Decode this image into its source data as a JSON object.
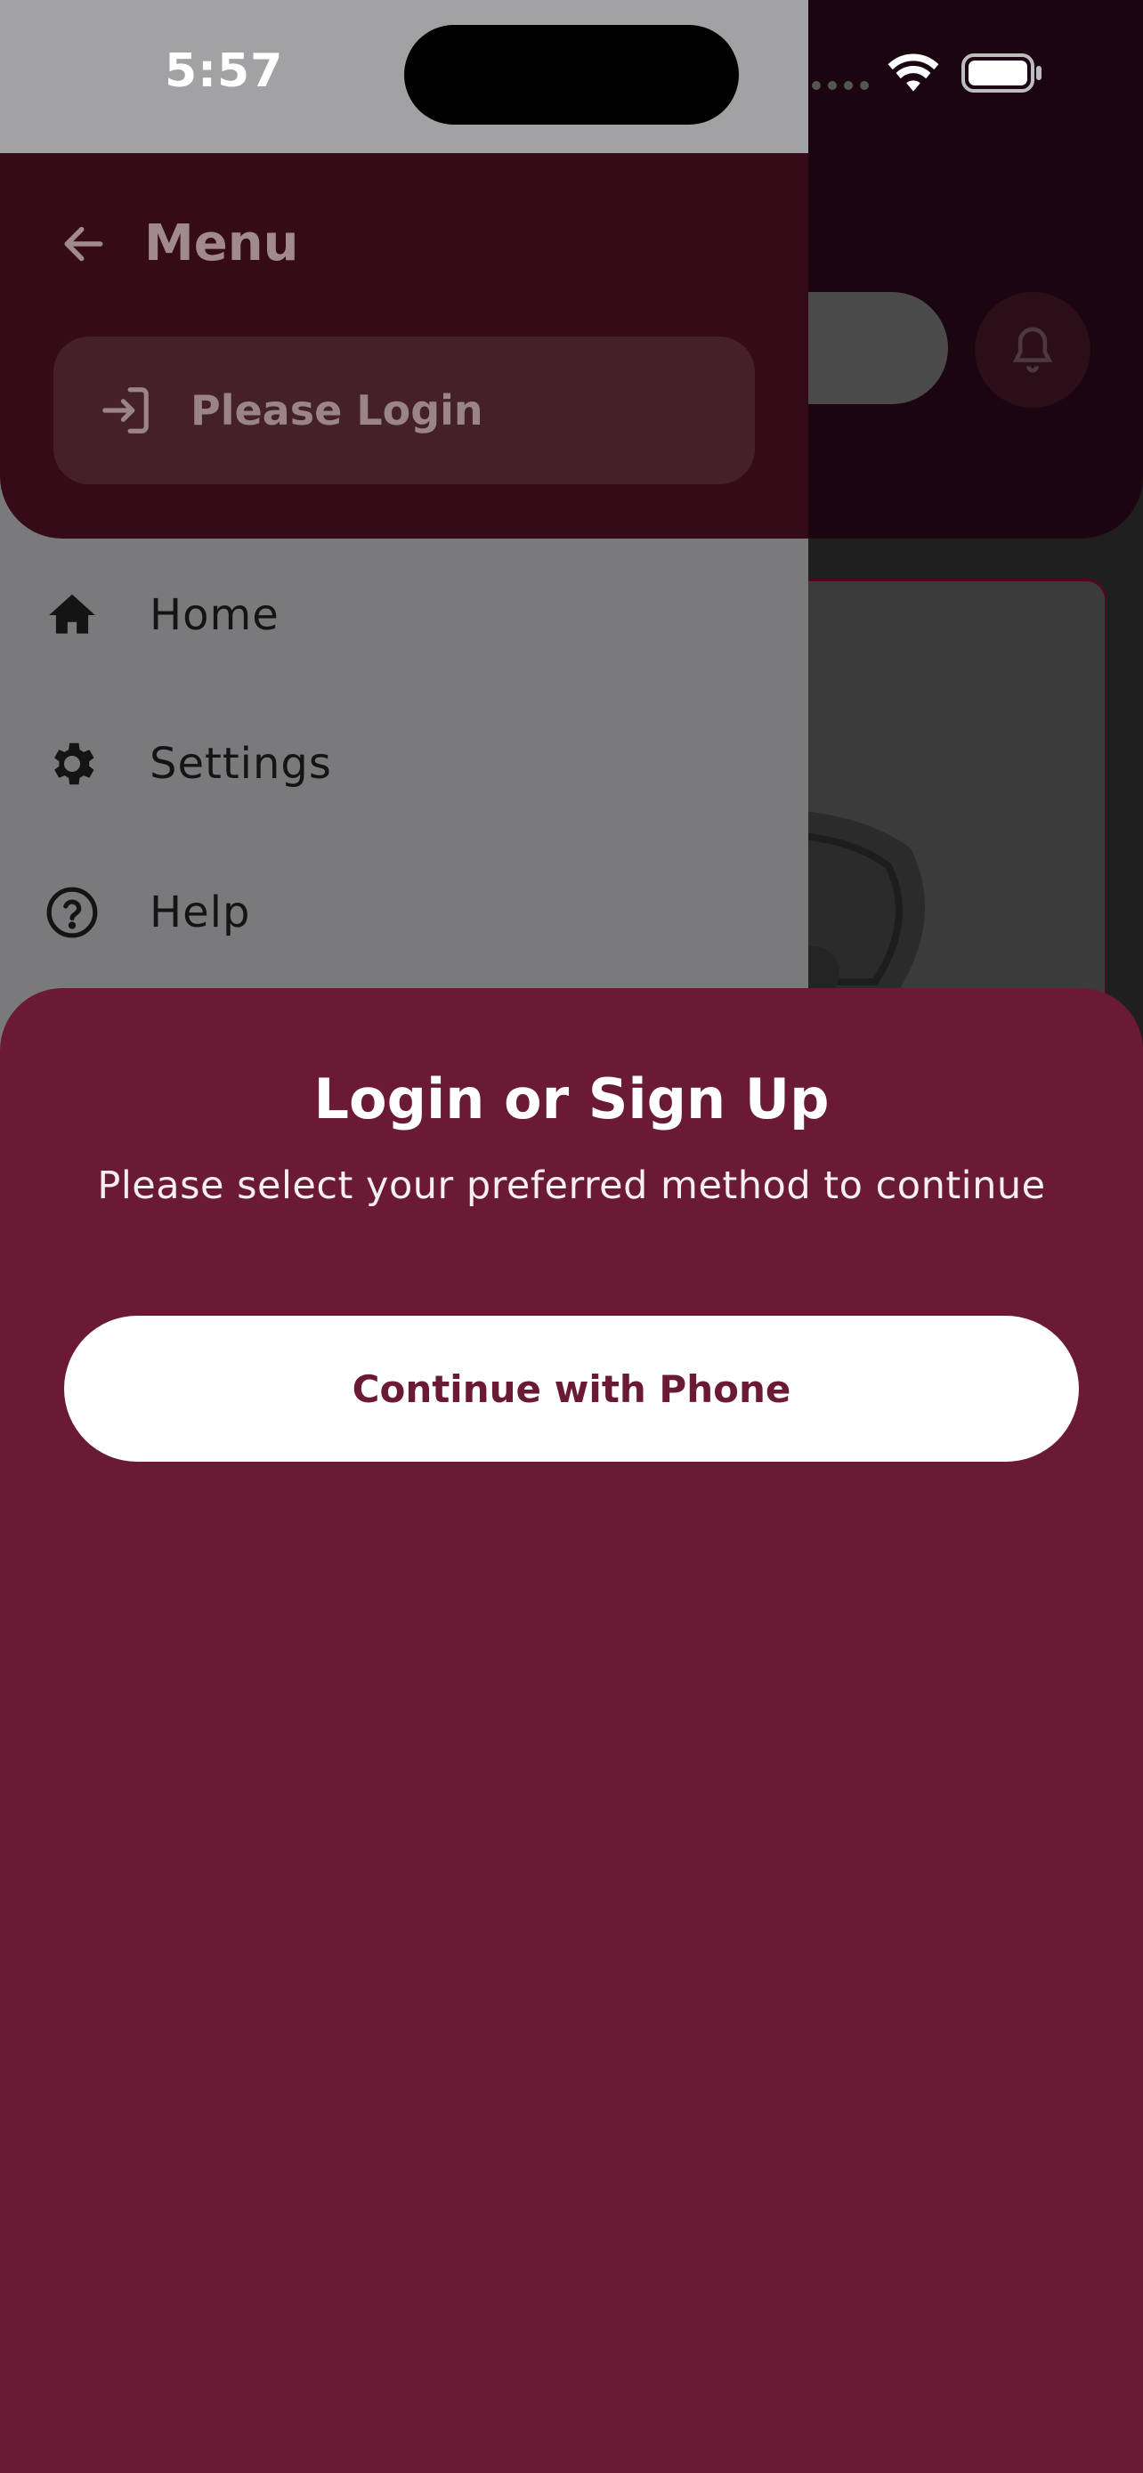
{
  "status_bar": {
    "time": "5:57"
  },
  "drawer": {
    "title": "Menu",
    "login_label": "Please Login",
    "items": [
      {
        "label": "Home",
        "icon": "home-icon"
      },
      {
        "label": "Settings",
        "icon": "gear-icon"
      },
      {
        "label": "Help",
        "icon": "help-circle-icon"
      }
    ]
  },
  "sheet": {
    "title": "Login or Sign Up",
    "subtitle": "Please select your preferred method to continue",
    "phone_button_label": "Continue with Phone"
  },
  "colors": {
    "brand": "#6a1a34",
    "brand_dark": "#360b18",
    "white": "#ffffff"
  }
}
